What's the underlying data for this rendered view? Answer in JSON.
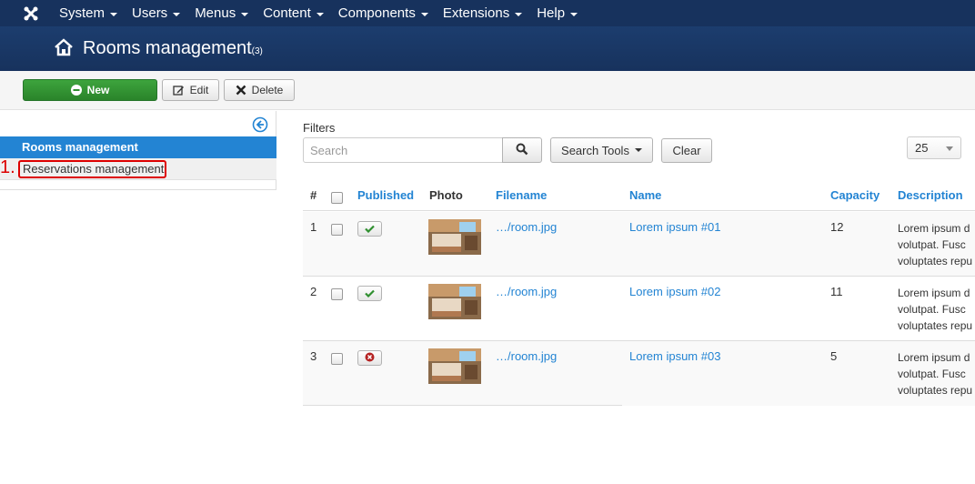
{
  "nav": {
    "items": [
      {
        "label": "System"
      },
      {
        "label": "Users"
      },
      {
        "label": "Menus"
      },
      {
        "label": "Content"
      },
      {
        "label": "Components"
      },
      {
        "label": "Extensions"
      },
      {
        "label": "Help"
      }
    ]
  },
  "header": {
    "title": "Rooms management",
    "count": "(3)"
  },
  "toolbar": {
    "new_label": "New",
    "edit_label": "Edit",
    "delete_label": "Delete"
  },
  "sidebar": {
    "items": [
      {
        "label": "Rooms management",
        "active": true
      },
      {
        "label": "Reservations management",
        "active": false
      }
    ],
    "annotation": "1."
  },
  "filters": {
    "label": "Filters",
    "search_placeholder": "Search",
    "search_tools_label": "Search Tools",
    "clear_label": "Clear",
    "limit_value": "25"
  },
  "table": {
    "headers": {
      "number": "#",
      "published": "Published",
      "photo": "Photo",
      "filename": "Filename",
      "name": "Name",
      "capacity": "Capacity",
      "description": "Description"
    },
    "rows": [
      {
        "number": "1",
        "published": true,
        "filename": "…/room.jpg",
        "name": "Lorem ipsum #01",
        "capacity": "12",
        "desc1": "Lorem ipsum d",
        "desc2": "volutpat. Fusc",
        "desc3": "voluptates repu"
      },
      {
        "number": "2",
        "published": true,
        "filename": "…/room.jpg",
        "name": "Lorem ipsum #02",
        "capacity": "11",
        "desc1": "Lorem ipsum d",
        "desc2": "volutpat. Fusc",
        "desc3": "voluptates repu"
      },
      {
        "number": "3",
        "published": false,
        "filename": "…/room.jpg",
        "name": "Lorem ipsum #03",
        "capacity": "5",
        "desc1": "Lorem ipsum d",
        "desc2": "volutpat. Fusc",
        "desc3": "voluptates repu"
      }
    ]
  },
  "colors": {
    "topbar": "#17325d",
    "accent": "#2384d3",
    "new_button": "#3da43d",
    "annotation": "#dd0000"
  }
}
